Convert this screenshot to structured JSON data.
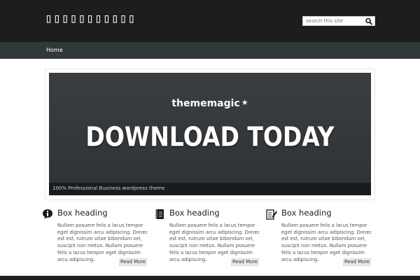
{
  "header": {
    "site_title": "▯▯▯▯▯▯▯▯▯▯▯",
    "search_placeholder": "search this site"
  },
  "nav": {
    "items": [
      {
        "label": "Home"
      }
    ]
  },
  "slider": {
    "brand": "thememagic",
    "brand_star": "★",
    "headline": "DOWNLOAD TODAY",
    "caption": "100% Professional Business wordpress theme"
  },
  "boxes": [
    {
      "icon": "info-icon",
      "title": "Box heading",
      "text": "Nullam posuere felis a lacus tempor eget dignissim arcu adipiscing. Donec est est, rutrum vitae bibendum vel, suscipit non metus. Nullam posuere felis a lacus tempor eget dignissim arcu adipiscing.",
      "button": "Read More"
    },
    {
      "icon": "notebook-icon",
      "title": "Box heading",
      "text": "Nullam posuere felis a lacus tempor eget dignissim arcu adipiscing. Donec est est, rutrum vitae bibendum vel, suscipit non metus. Nullam posuere felis a lacus tempor eget dignissim arcu adipiscing.",
      "button": "Read More"
    },
    {
      "icon": "edit-notes-icon",
      "title": "Box heading",
      "text": "Nullam posuere felis a lacus tempor eget dignissim arcu adipiscing. Donec est est, rutrum vitae bibendum vel, suscipit non metus. Nullam posuere felis a lacus tempor eget dignissim arcu adipiscing.",
      "button": "Read More"
    }
  ],
  "colors": {
    "header_bg": "#1d1d1d",
    "nav_bg": "#313839",
    "slider_bg": "#3b3e41",
    "caption_bg": "#1a1b1c",
    "button_bg": "#e9e9e9"
  }
}
